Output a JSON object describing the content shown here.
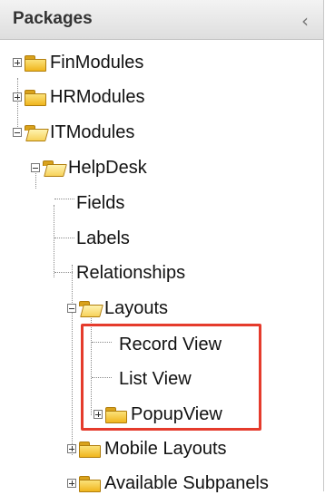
{
  "panel": {
    "title": "Packages",
    "collapse_glyph": "‹"
  },
  "tree": {
    "finmodules": "FinModules",
    "hrmodules": "HRModules",
    "itmodules": "ITModules",
    "helpdesk": "HelpDesk",
    "fields": "Fields",
    "labels": "Labels",
    "relationships": "Relationships",
    "layouts": "Layouts",
    "record_view": "Record View",
    "list_view": "List View",
    "popup_view": "PopupView",
    "mobile_layouts": "Mobile Layouts",
    "available_subpanels": "Available Subpanels"
  },
  "icons": {
    "expand": "plus-toggle-icon",
    "collapse": "minus-toggle-icon",
    "folder_closed": "folder-icon",
    "folder_open": "folder-open-icon"
  },
  "colors": {
    "highlight": "#e53b2c",
    "folder": "#f0b51d"
  }
}
